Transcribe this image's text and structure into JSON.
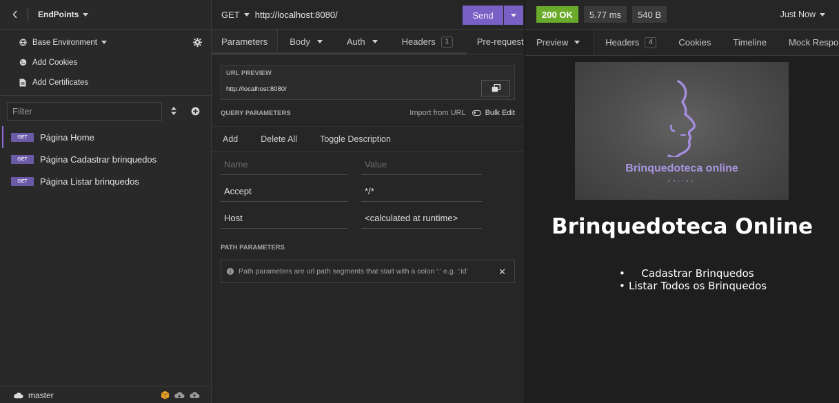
{
  "sidebar": {
    "workspace_title": "EndPoints",
    "options": {
      "environment": "Base Environment",
      "add_cookies": "Add Cookies",
      "add_certificates": "Add Certificates"
    },
    "filter_placeholder": "Filter",
    "requests": [
      {
        "method": "GET",
        "name": "Página Home"
      },
      {
        "method": "GET",
        "name": "Página Cadastrar brinquedos"
      },
      {
        "method": "GET",
        "name": "Página Listar brinquedos"
      }
    ],
    "branch": "master"
  },
  "request": {
    "method": "GET",
    "url": "http://localhost:8080/",
    "send_label": "Send",
    "tabs": {
      "parameters": "Parameters",
      "body": "Body",
      "auth": "Auth",
      "headers": "Headers",
      "headers_count": "1",
      "prerequest": "Pre-request S"
    },
    "url_preview_label": "URL PREVIEW",
    "url_preview_value": "http://localhost:8080/",
    "query_params_label": "QUERY PARAMETERS",
    "import_from_url": "Import from URL",
    "bulk_edit": "Bulk Edit",
    "actions": {
      "add": "Add",
      "delete_all": "Delete All",
      "toggle_description": "Toggle Description"
    },
    "name_placeholder": "Name",
    "value_placeholder": "Value",
    "params": [
      {
        "name": "Accept",
        "value": "*/*"
      },
      {
        "name": "Host",
        "value": "<calculated at runtime>"
      }
    ],
    "path_params_label": "PATH PARAMETERS",
    "path_params_note": "Path parameters are url path segments that start with a colon ':' e.g. ':id'"
  },
  "response": {
    "status": "200 OK",
    "time": "5.77 ms",
    "size": "540 B",
    "when": "Just Now",
    "tabs": {
      "preview": "Preview",
      "headers": "Headers",
      "headers_count": "4",
      "cookies": "Cookies",
      "timeline": "Timeline",
      "mock": "Mock Respons"
    },
    "preview": {
      "logo_text": "Brinquedoteca online",
      "logo_sub": "ONLINE",
      "heading": "Brinquedoteca Online",
      "links": [
        "Cadastrar Brinquedos",
        "Listar Todos os Brinquedos"
      ]
    }
  },
  "colors": {
    "accent": "#7860c4",
    "method_badge": "#6b5ba7",
    "status_ok": "#6aab2c",
    "logo": "#a995e0"
  }
}
